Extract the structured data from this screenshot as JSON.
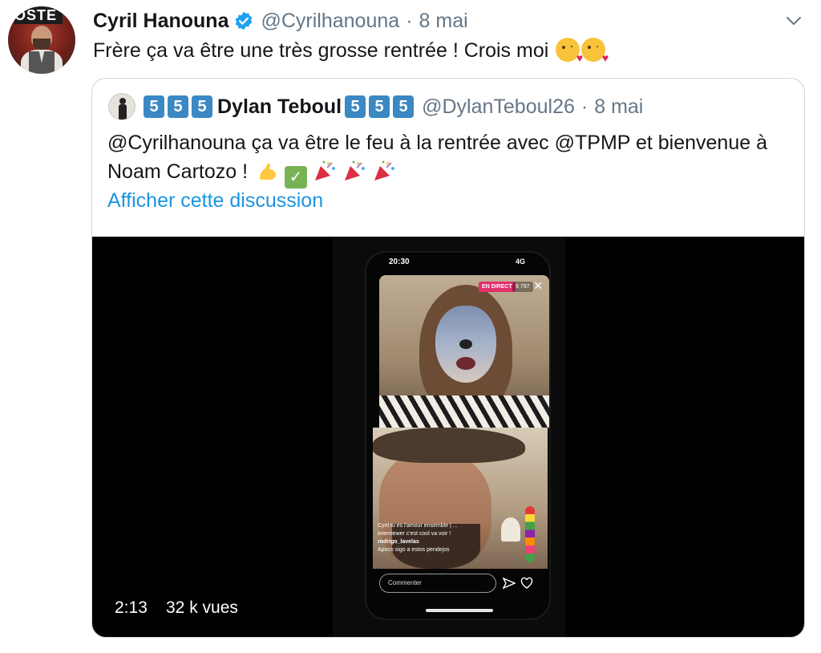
{
  "tweet": {
    "author_name": "Cyril Hanouna",
    "handle": "@Cyrilhanouna",
    "separator": "·",
    "date": "8 mai",
    "text": "Frère ça va être une très grosse rentrée ! Crois moi",
    "avatar_banner": "OSTE",
    "emojis": [
      "kissing-face-with-heart-icon",
      "kissing-face-with-heart-icon"
    ]
  },
  "quoted": {
    "keycap": "5",
    "author_name": "Dylan Teboul",
    "handle": "@DylanTeboul26",
    "separator": "·",
    "date": "8 mai",
    "text_line1": "@Cyrilhanouna ça va être le feu à la rentrée avec @TPMP et bienvenue à",
    "text_line2": "Noam Cartozo !",
    "show_thread": "Afficher cette discussion"
  },
  "video": {
    "duration": "2:13",
    "views": "32 k vues",
    "phone_time": "20:30",
    "phone_signal": "4G",
    "live_badge": "EN DIRECT",
    "viewer_count": "9 797",
    "comment_line1": "Cyril tu es l'amour ensemble | ...",
    "comment_line2": "interviewer c'est cool va voir !",
    "comment_user": "rodrigo_lavelas",
    "comment_text": "Apoco sigo a estos pendejos",
    "comment_placeholder": "Commenter"
  },
  "colors": {
    "link": "#1b95e0",
    "secondary_text": "#657786",
    "verified": "#1da1f2",
    "border": "#ccd6dd",
    "keycap": "#3b88c3"
  }
}
